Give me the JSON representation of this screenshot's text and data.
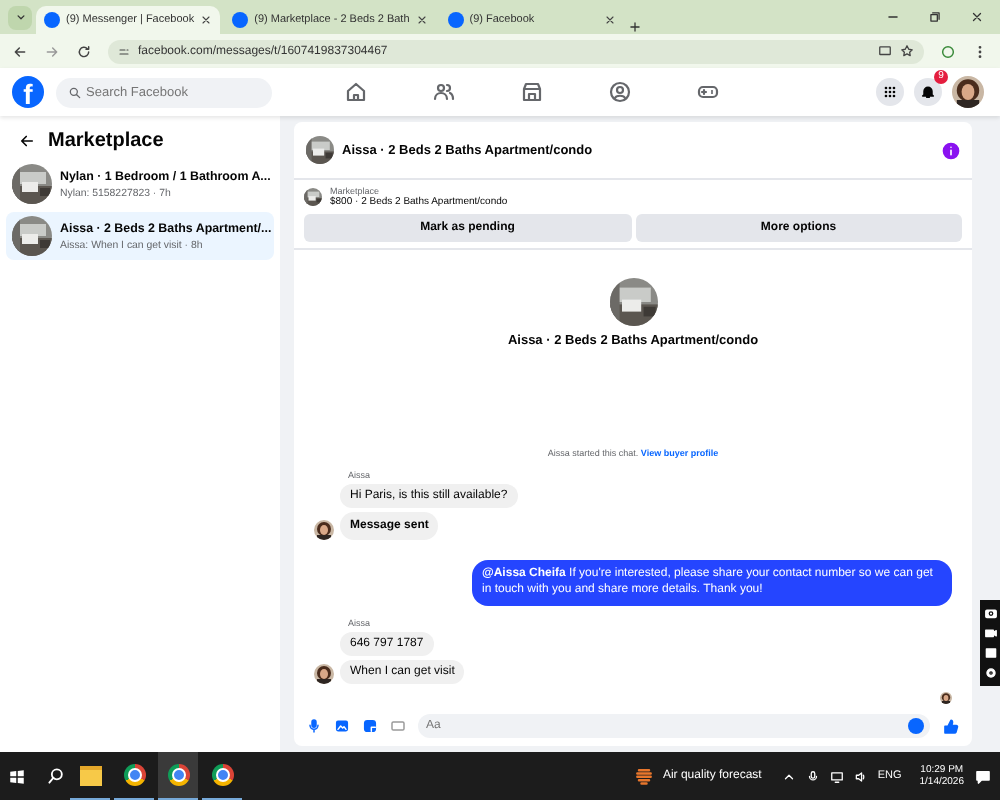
{
  "browser": {
    "tabs": [
      {
        "title": "(9) Messenger | Facebook",
        "selected": true
      },
      {
        "title": "(9) Marketplace - 2 Beds 2 Bath",
        "selected": false
      },
      {
        "title": "(9) Facebook",
        "selected": false
      }
    ],
    "url": "facebook.com/messages/t/1607419837304467"
  },
  "header": {
    "logo": "f",
    "search": {
      "placeholder": "Search Facebook"
    },
    "notification_count": "9"
  },
  "sidebar": {
    "title": "Marketplace",
    "conversations": [
      {
        "title": "Nylan · 1 Bedroom / 1 Bathroom A...",
        "preview": "Nylan: 5158227823 · 7h",
        "selected": false
      },
      {
        "title": "Aissa · 2 Beds 2 Baths Apartment/...",
        "preview": "Aissa: When I can get visit · 8h",
        "selected": true
      }
    ]
  },
  "chat": {
    "title": "Aissa · 2 Beds 2 Baths Apartment/condo",
    "listing": {
      "label": "Marketplace",
      "description": "$800 · 2 Beds 2 Baths Apartment/condo",
      "buttons": [
        "Mark as pending",
        "More options"
      ]
    },
    "intro_title": "Aissa · 2 Beds 2 Baths Apartment/condo",
    "started": {
      "text": "Aissa started this chat.",
      "link": "View buyer profile"
    },
    "groups": [
      {
        "kind": "incoming",
        "sender": "Aissa",
        "messages": [
          {
            "kind": "text",
            "text": "Hi Paris, is this still available?"
          },
          {
            "kind": "notice",
            "text": "Message sent"
          }
        ]
      },
      {
        "kind": "outgoing",
        "messages": [
          {
            "kind": "text",
            "text": "**@Aissa Cheifa** If you're interested, please share your contact number so we can get in touch with you and share more details. Thank you!"
          }
        ]
      },
      {
        "kind": "incoming",
        "sender": "Aissa",
        "messages": [
          {
            "kind": "text",
            "text": "646 797 1787"
          },
          {
            "kind": "text",
            "text": "When I can get visit"
          }
        ]
      }
    ],
    "composer": {
      "placeholder": "Aa"
    }
  },
  "taskbar": {
    "apps": [
      {
        "kind": "folder",
        "selected": false
      },
      {
        "kind": "chrome",
        "selected": false
      },
      {
        "kind": "chrome",
        "selected": true
      },
      {
        "kind": "chrome",
        "selected": false
      }
    ],
    "weather": "Air quality forecast",
    "language": "ENG",
    "time": "10:29 PM",
    "date": "1/14/2026"
  }
}
